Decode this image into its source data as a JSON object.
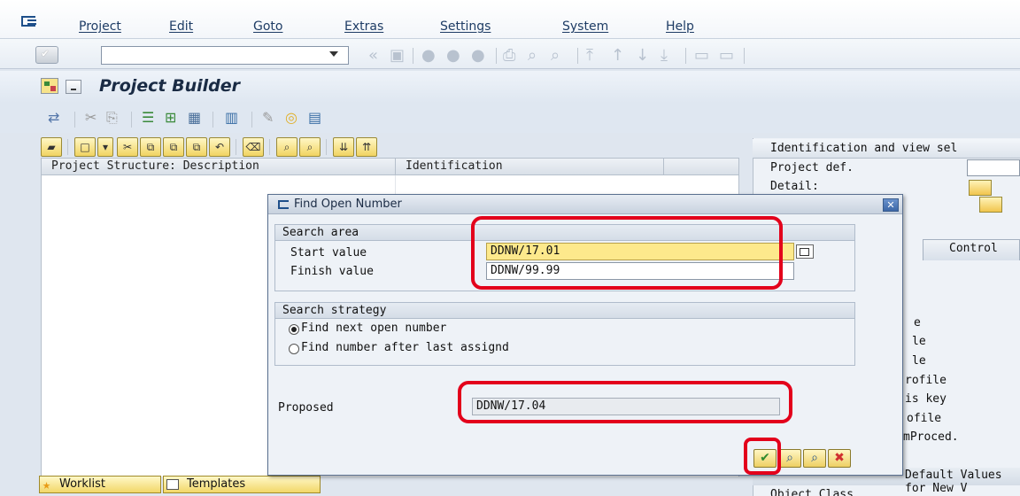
{
  "menu": {
    "items": [
      "Project",
      "Edit",
      "Goto",
      "Extras",
      "Settings",
      "System",
      "Help"
    ]
  },
  "toolbar": {
    "command_value": ""
  },
  "title": "Project Builder",
  "tree": {
    "columns": [
      "Project Structure: Description",
      "Identification"
    ]
  },
  "bottom_tabs": {
    "worklist": "Worklist",
    "templates": "Templates"
  },
  "right_panel": {
    "header": "Identification and view sel",
    "project_def_label": "Project def.",
    "detail_label": "Detail:",
    "control_tab": "Control",
    "partial_labels": [
      "e",
      "le",
      "le",
      "rofile",
      "is key",
      "ofile",
      "mProced."
    ],
    "section2_header": "Default Values for New V",
    "object_class_label": "Object Class"
  },
  "dialog": {
    "title": "Find Open Number",
    "search_area": {
      "title": "Search area",
      "start_label": "Start value",
      "start_value": "DDNW/17.01",
      "finish_label": "Finish value",
      "finish_value": "DDNW/99.99"
    },
    "search_strategy": {
      "title": "Search strategy",
      "option1": "Find next open number",
      "option2": "Find number after last assignd",
      "selected": 1
    },
    "proposed_label": "Proposed",
    "proposed_value": "DDNW/17.04"
  },
  "colors": {
    "highlight": "#e3001b",
    "accent": "#1e4f8a",
    "input_focus": "#fde98c"
  }
}
